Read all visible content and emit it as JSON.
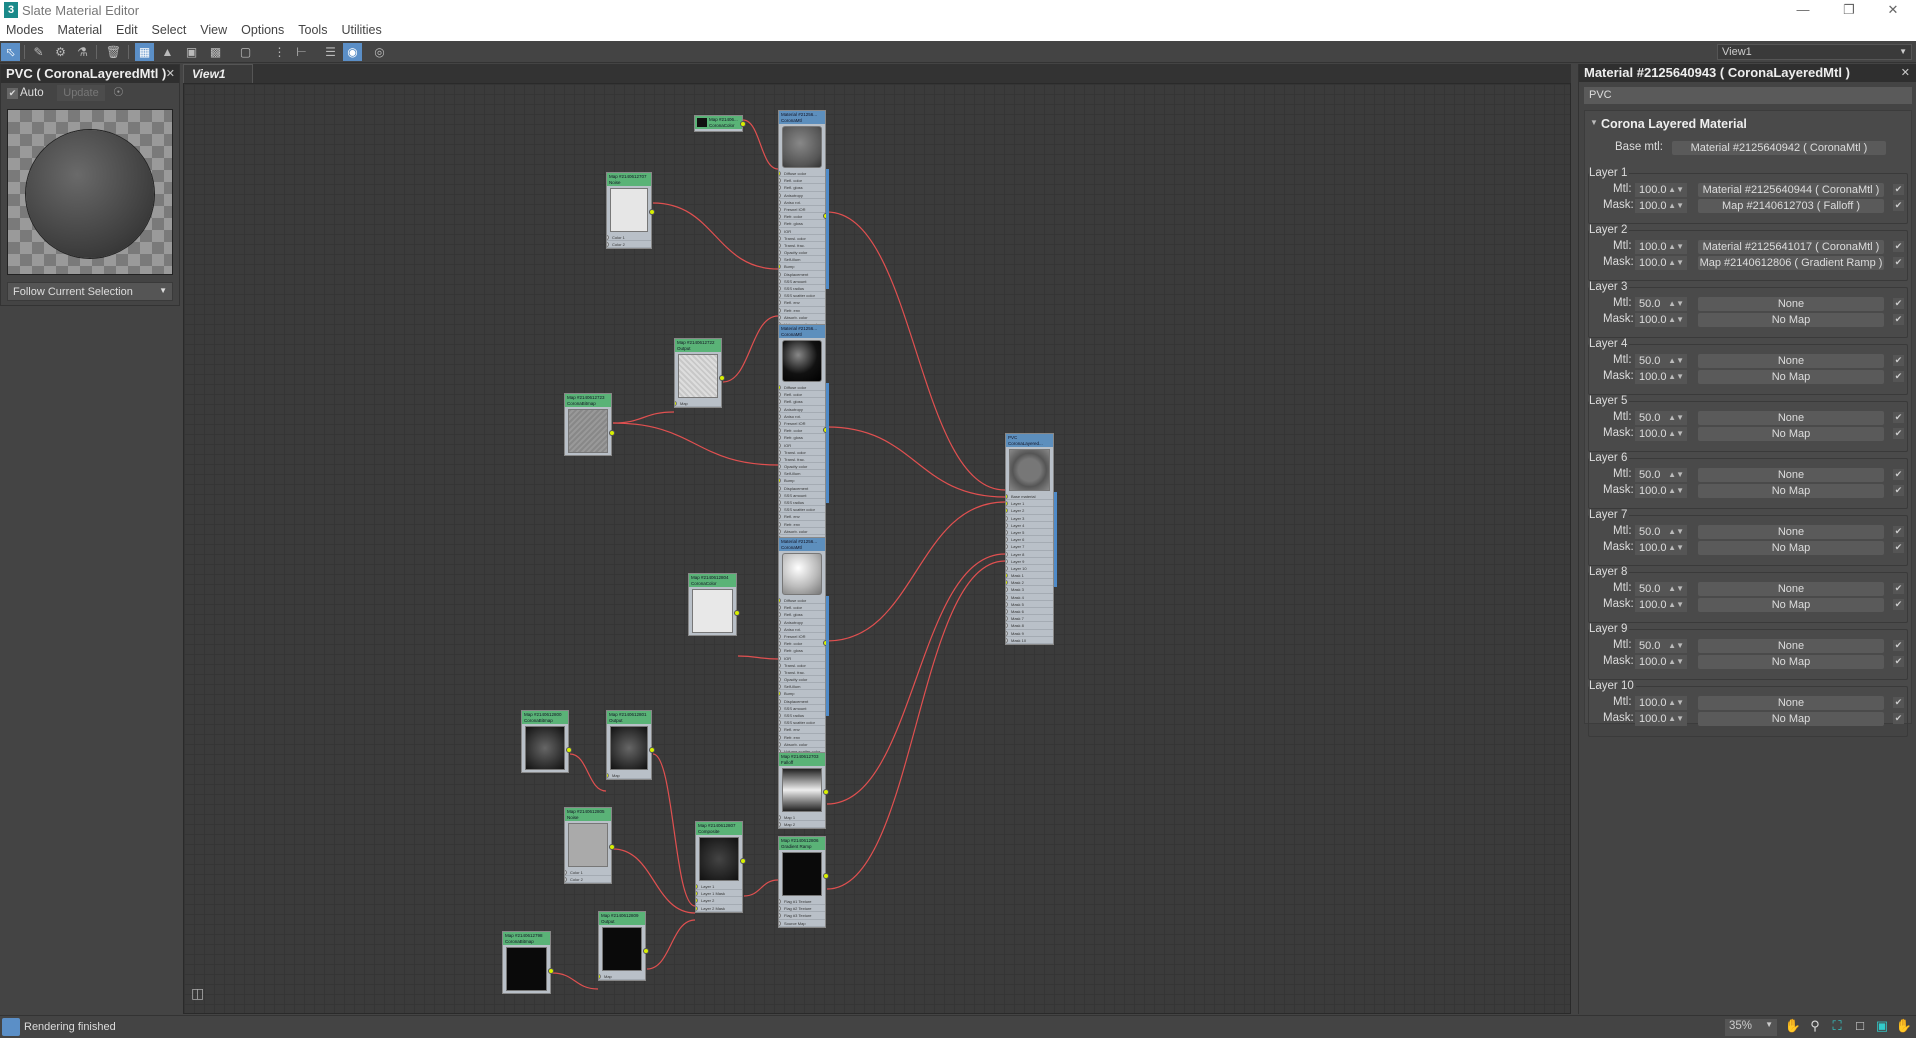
{
  "window": {
    "title": "Slate Material Editor",
    "app_icon": "3"
  },
  "menu": [
    "Modes",
    "Material",
    "Edit",
    "Select",
    "View",
    "Options",
    "Tools",
    "Utilities"
  ],
  "toolbar": {
    "view_selector": "View1"
  },
  "left_panel": {
    "title": "PVC  ( CoronaLayeredMtl )",
    "auto_label": "Auto",
    "update_label": "Update",
    "follow_dropdown": "Follow Current Selection"
  },
  "view": {
    "tab": "View1"
  },
  "nodes": {
    "color1": {
      "title": "Map #21406...",
      "type": "CoronaColor",
      "ports": []
    },
    "mtl1": {
      "title": "Material #21256...",
      "type": "CoronaMtl"
    },
    "noise1": {
      "title": "Map #2140612707",
      "type": "Noise",
      "ports": [
        "Color 1",
        "Color 2"
      ]
    },
    "mtl2": {
      "title": "Material #21256...",
      "type": "CoronaMtl"
    },
    "output1": {
      "title": "Map #2140612722",
      "type": "Output",
      "ports": [
        "Map"
      ]
    },
    "bitmap1": {
      "title": "Map #2140612723",
      "type": "CoronaBitmap",
      "ports": []
    },
    "mtl3": {
      "title": "Material #21256...",
      "type": "CoronaMtl"
    },
    "color2": {
      "title": "Map #2140612804",
      "type": "CoronaColor",
      "ports": []
    },
    "bitmap2": {
      "title": "Map #2140612800",
      "type": "CoronaBitmap",
      "ports": []
    },
    "output2": {
      "title": "Map #2140612801",
      "type": "Output",
      "ports": [
        "Map"
      ]
    },
    "falloff": {
      "title": "Map #2140612703",
      "type": "Falloff",
      "ports": [
        "Map 1",
        "Map 2"
      ]
    },
    "noise2": {
      "title": "Map #2140612805",
      "type": "Noise",
      "ports": [
        "Color 1",
        "Color 2"
      ]
    },
    "composite": {
      "title": "Map #2140612807",
      "type": "Composite",
      "ports": [
        "Layer 1",
        "Layer 1 Mask",
        "Layer 2",
        "Layer 2 Mask"
      ]
    },
    "gradient": {
      "title": "Map #2140612806",
      "type": "Gradient Ramp",
      "ports": [
        "Flag #1 Texture",
        "Flag #2 Texture",
        "Flag #3 Texture",
        "Source Map"
      ]
    },
    "output3": {
      "title": "Map #2140612809",
      "type": "Output",
      "ports": [
        "Map"
      ]
    },
    "bitmap3": {
      "title": "Map #2140612798",
      "type": "CoronaBitmap",
      "ports": []
    },
    "pvc": {
      "title": "PVC",
      "type": "CoronaLayered...",
      "ports": [
        "Base material",
        "Layer 1",
        "Layer 2",
        "Layer 3",
        "Layer 4",
        "Layer 5",
        "Layer 6",
        "Layer 7",
        "Layer 8",
        "Layer 9",
        "Layer 10",
        "Mask 1",
        "Mask 2",
        "Mask 3",
        "Mask 4",
        "Mask 5",
        "Mask 6",
        "Mask 7",
        "Mask 8",
        "Mask 9",
        "Mask 10"
      ]
    }
  },
  "mtl_ports": [
    "Diffuse color",
    "Refl. color",
    "Refl. gloss",
    "Anisotropy",
    "Aniso rot.",
    "Fresnel IOR",
    "Refr. color",
    "Refr. gloss",
    "IOR",
    "Transl. color",
    "Transl. frac.",
    "Opacity color",
    "Self-illum",
    "Bump",
    "Displacement",
    "SSS amount",
    "SSS radius",
    "SSS scatter color",
    "Refl. env",
    "Refr. env",
    "Absorb. color",
    "Volume scatter color"
  ],
  "right_panel": {
    "title": "Material #2125640943  ( CoronaLayeredMtl )",
    "name": "PVC",
    "rollout_title": "Corona Layered Material",
    "base_label": "Base mtl:",
    "base_value": "Material #2125640942  ( CoronaMtl )",
    "mtl_label": "Mtl:",
    "mask_label": "Mask:",
    "layers": [
      {
        "label": "Layer 1",
        "mtl_amount": "100.0",
        "mtl": "Material #2125640944  ( CoronaMtl )",
        "mask_amount": "100.0",
        "mask": "Map #2140612703  ( Falloff )"
      },
      {
        "label": "Layer 2",
        "mtl_amount": "100.0",
        "mtl": "Material #2125641017  ( CoronaMtl )",
        "mask_amount": "100.0",
        "mask": "Map #2140612806  ( Gradient Ramp )"
      },
      {
        "label": "Layer 3",
        "mtl_amount": "50.0",
        "mtl": "None",
        "mask_amount": "100.0",
        "mask": "No Map"
      },
      {
        "label": "Layer 4",
        "mtl_amount": "50.0",
        "mtl": "None",
        "mask_amount": "100.0",
        "mask": "No Map"
      },
      {
        "label": "Layer 5",
        "mtl_amount": "50.0",
        "mtl": "None",
        "mask_amount": "100.0",
        "mask": "No Map"
      },
      {
        "label": "Layer 6",
        "mtl_amount": "50.0",
        "mtl": "None",
        "mask_amount": "100.0",
        "mask": "No Map"
      },
      {
        "label": "Layer 7",
        "mtl_amount": "50.0",
        "mtl": "None",
        "mask_amount": "100.0",
        "mask": "No Map"
      },
      {
        "label": "Layer 8",
        "mtl_amount": "50.0",
        "mtl": "None",
        "mask_amount": "100.0",
        "mask": "No Map"
      },
      {
        "label": "Layer 9",
        "mtl_amount": "50.0",
        "mtl": "None",
        "mask_amount": "100.0",
        "mask": "No Map"
      },
      {
        "label": "Layer 10",
        "mtl_amount": "100.0",
        "mtl": "None",
        "mask_amount": "100.0",
        "mask": "No Map"
      }
    ]
  },
  "status": {
    "text": "Rendering finished",
    "zoom": "35%"
  },
  "colors": {
    "wire": "#e05050",
    "map_header": "#5ab377",
    "mtl_header": "#5d8fbd",
    "accent": "#5b8fc7"
  }
}
